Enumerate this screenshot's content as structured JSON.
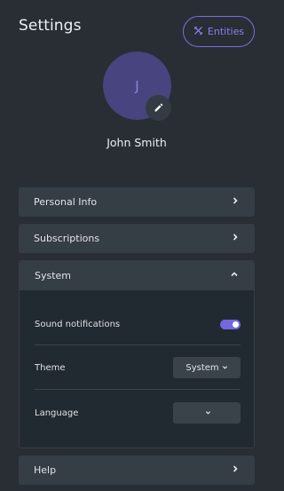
{
  "header": {
    "title": "Settings",
    "entities_label": "Entities",
    "entities_icon": "tools-icon"
  },
  "profile": {
    "avatar_initial": "J",
    "name": "John Smith",
    "edit_icon": "pencil-icon"
  },
  "sections": {
    "personal_info": "Personal Info",
    "subscriptions": "Subscriptions",
    "system": "System",
    "help": "Help"
  },
  "system": {
    "sound_notifications_label": "Sound notifications",
    "sound_notifications_enabled": true,
    "theme_label": "Theme",
    "theme_value": "System",
    "language_label": "Language",
    "language_value": ""
  },
  "colors": {
    "background": "#282e34",
    "card": "#353d45",
    "accent": "#7567e0",
    "avatar": "#47447f"
  }
}
